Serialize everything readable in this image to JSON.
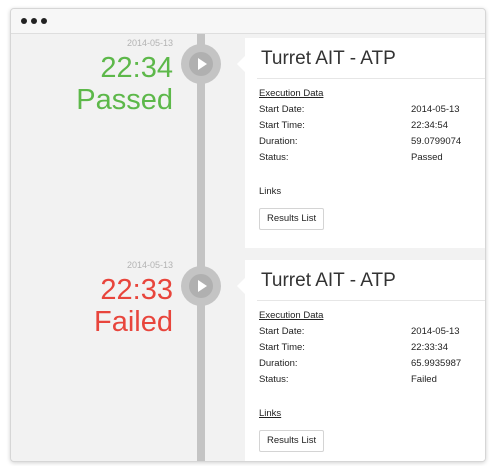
{
  "window": {
    "controls": [
      "dot",
      "dot",
      "dot"
    ]
  },
  "entries": [
    {
      "date": "2014-05-13",
      "time": "22:34",
      "status_big": "Passed",
      "title": "Turret AIT - ATP",
      "section": "Execution Data",
      "fields": [
        {
          "key": "Start Date:",
          "value": "2014-05-13"
        },
        {
          "key": "Start Time:",
          "value": "22:34:54"
        },
        {
          "key": "Duration:",
          "value": "59.0799074"
        },
        {
          "key": "Status:",
          "value": "Passed"
        }
      ],
      "links_label": "Links",
      "button_label": "Results List"
    },
    {
      "date": "2014-05-13",
      "time": "22:33",
      "status_big": "Failed",
      "title": "Turret AIT - ATP",
      "section": "Execution Data",
      "fields": [
        {
          "key": "Start Date:",
          "value": "2014-05-13"
        },
        {
          "key": "Start Time:",
          "value": "22:33:34"
        },
        {
          "key": "Duration:",
          "value": "65.9935987"
        },
        {
          "key": "Status:",
          "value": "Failed"
        }
      ],
      "links_label": "Links",
      "button_label": "Results List"
    }
  ],
  "colors": {
    "passed": "#5db84a",
    "failed": "#e8453c",
    "rail": "#c4c4c4"
  },
  "icons": {
    "play": "play-icon"
  }
}
